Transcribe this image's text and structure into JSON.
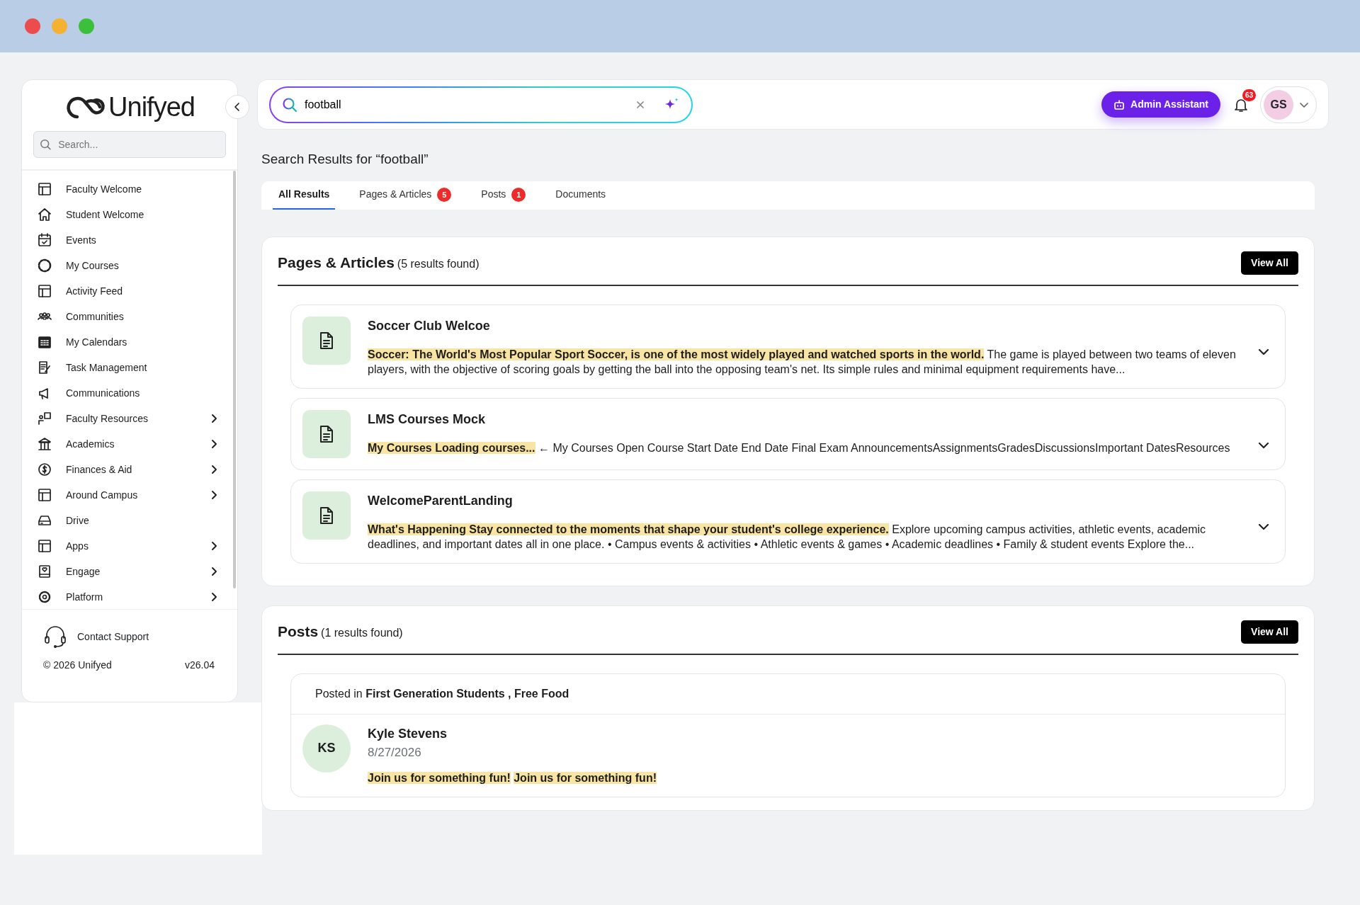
{
  "window": {
    "controls": [
      {
        "color": "#ed4c4c"
      },
      {
        "color": "#f5b132"
      },
      {
        "color": "#3cc03c"
      }
    ]
  },
  "sidebar": {
    "logo": "Unifyed",
    "search": {
      "placeholder": "Search..."
    },
    "items": [
      {
        "label": "Faculty Welcome",
        "expandable": false
      },
      {
        "label": "Student Welcome",
        "expandable": false
      },
      {
        "label": "Events",
        "expandable": false
      },
      {
        "label": "My Courses",
        "expandable": false
      },
      {
        "label": "Activity Feed",
        "expandable": false
      },
      {
        "label": "Communities",
        "expandable": false
      },
      {
        "label": "My Calendars",
        "expandable": false
      },
      {
        "label": "Task Management",
        "expandable": false
      },
      {
        "label": "Communications",
        "expandable": false
      },
      {
        "label": "Faculty Resources",
        "expandable": true
      },
      {
        "label": "Academics",
        "expandable": true
      },
      {
        "label": "Finances & Aid",
        "expandable": true
      },
      {
        "label": "Around Campus",
        "expandable": true
      },
      {
        "label": "Drive",
        "expandable": false
      },
      {
        "label": "Apps",
        "expandable": true
      },
      {
        "label": "Engage",
        "expandable": true
      },
      {
        "label": "Platform",
        "expandable": true
      }
    ],
    "support": "Contact Support",
    "copyright": "© 2026 Unifyed",
    "version": "v26.04"
  },
  "header": {
    "search": {
      "value": "football"
    },
    "assistant": "Admin Assistant",
    "notifications": "63",
    "avatar": "GS"
  },
  "results_title": "Search Results for “football”",
  "tabs": [
    {
      "label": "All Results",
      "selected": true
    },
    {
      "label": "Pages & Articles",
      "count": "5",
      "selected": false
    },
    {
      "label": "Posts",
      "count": "1",
      "selected": false
    },
    {
      "label": "Documents",
      "selected": false
    }
  ],
  "pages": {
    "title": "Pages & Articles",
    "found": "(5 results found)",
    "view_all": "View All",
    "items": [
      {
        "title": "Soccer Club Welcoe",
        "highlight": "Soccer: The World's Most Popular Sport Soccer, is one of the most widely played and watched sports in the world.",
        "text": "The game is played between two teams of eleven players, with the objective of scoring goals by getting the ball into the opposing team's net. Its simple rules and minimal equipment requirements have..."
      },
      {
        "title": "LMS Courses Mock",
        "highlight": "My Courses Loading courses...",
        "text": "← My Courses Open Course Start Date End Date Final Exam AnnouncementsAssignmentsGradesDiscussionsImportant DatesResources"
      },
      {
        "title": "WelcomeParentLanding",
        "highlight": "What's Happening Stay connected to the moments that shape your student's college experience.",
        "text": "Explore upcoming campus activities, athletic events, academic deadlines, and important dates all in one place. • Campus events & activities • Athletic events & games • Academic deadlines • Family & student events Explore the..."
      }
    ]
  },
  "posts": {
    "title": "Posts",
    "found": "(1 results found)",
    "view_all": "View All",
    "items": [
      {
        "posted_in_label": "Posted in",
        "groups": "First Generation Students , Free Food",
        "initials": "KS",
        "author": "Kyle Stevens",
        "date": "8/27/2026",
        "highlights": [
          "Join us for something fun!",
          "Join us for something fun!"
        ]
      }
    ]
  }
}
